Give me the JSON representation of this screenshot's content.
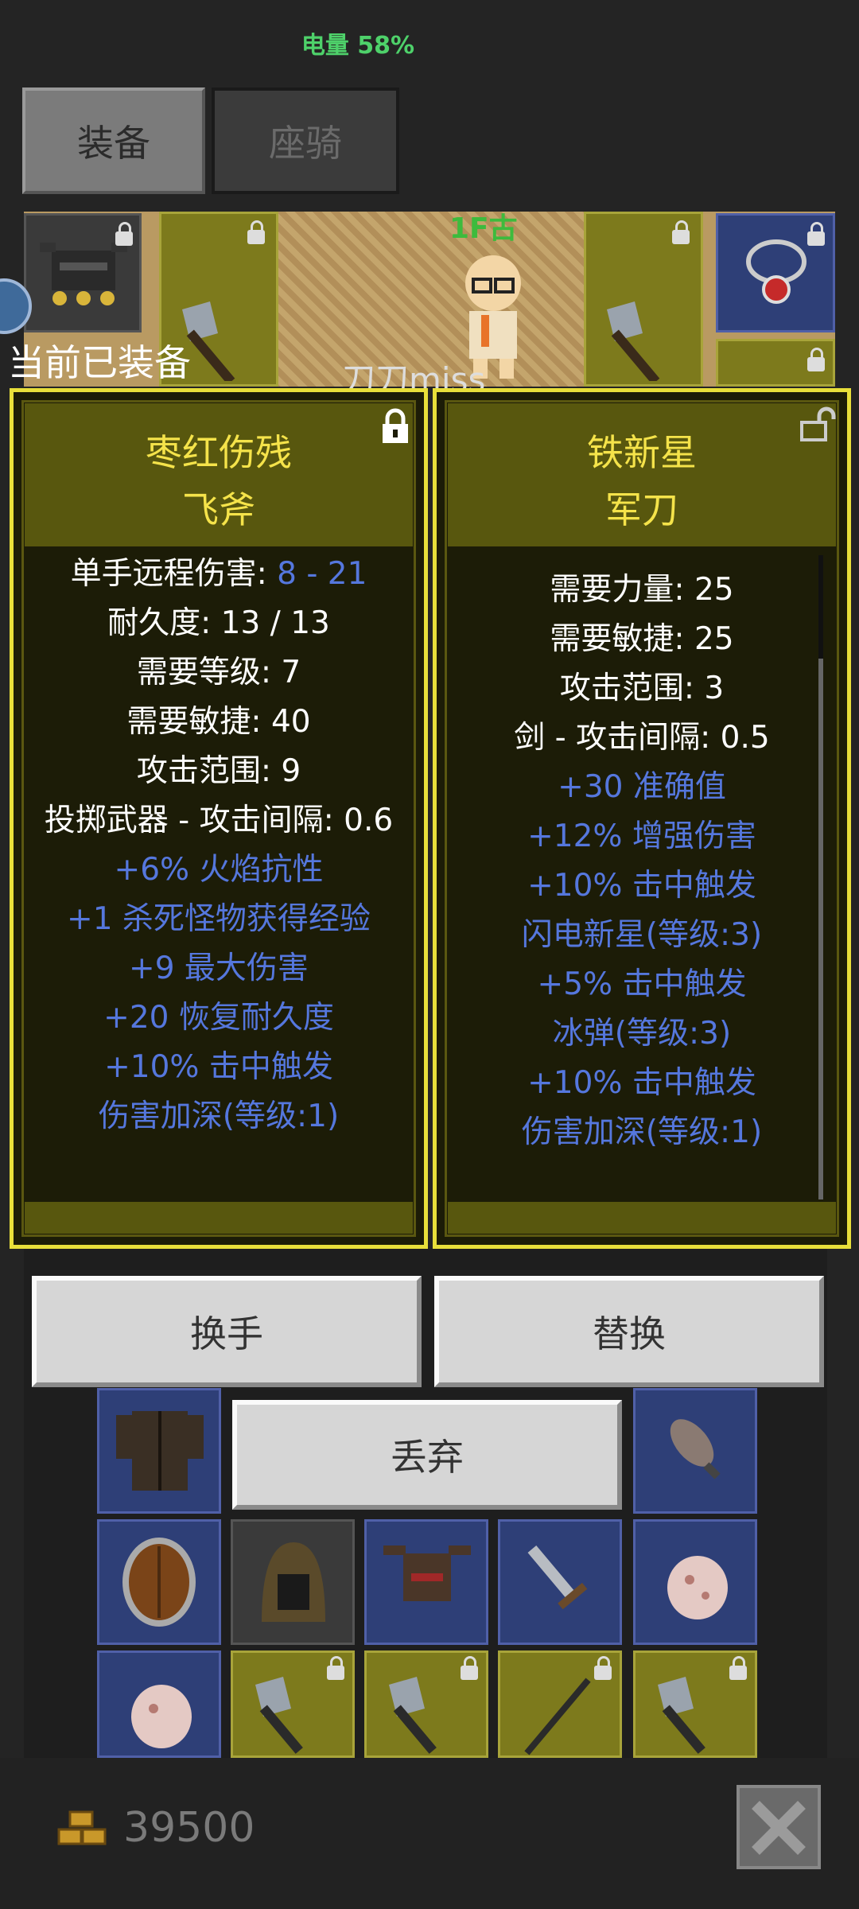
{
  "status_bar": {
    "battery": "电量 58%"
  },
  "tabs": [
    {
      "label": "装备"
    },
    {
      "label": "座骑"
    }
  ],
  "scene": {
    "floor_label": "1F古",
    "combat_text": "刀刀miss"
  },
  "equipped_label": "当前已装备",
  "left_item": {
    "name_line1": "枣红伤残",
    "name_line2": "飞斧",
    "locked": true,
    "stats": [
      {
        "label": "单手远程伤害: ",
        "value": "8 - 21"
      },
      {
        "text": "耐久度: 13 / 13"
      },
      {
        "text": "需要等级: 7"
      },
      {
        "text": "需要敏捷: 40"
      },
      {
        "text": "攻击范围: 9"
      },
      {
        "text": "投掷武器 - 攻击间隔: 0.6"
      }
    ],
    "affixes": [
      "+6% 火焰抗性",
      "+1 杀死怪物获得经验",
      "+9 最大伤害",
      "+20 恢复耐久度",
      "+10% 击中触发",
      "伤害加深(等级:1)"
    ]
  },
  "right_item": {
    "name_line1": "铁新星",
    "name_line2": "军刀",
    "locked": false,
    "stats": [
      {
        "text": "需要力量: 25"
      },
      {
        "text": "需要敏捷: 25"
      },
      {
        "text": "攻击范围: 3"
      },
      {
        "text": "剑 - 攻击间隔: 0.5"
      }
    ],
    "affixes": [
      "+30 准确值",
      "+12% 增强伤害",
      "+10% 击中触发",
      "闪电新星(等级:3)",
      "+5% 击中触发",
      "冰弹(等级:3)",
      "+10% 击中触发",
      "伤害加深(等级:1)"
    ]
  },
  "buttons": {
    "swap_hand": "换手",
    "replace": "替换",
    "discard": "丢弃"
  },
  "gold": {
    "amount": "39500"
  },
  "colors": {
    "panel_border": "#e8df3a",
    "item_name": "#f5e34a",
    "affix": "#5577dd",
    "battery": "#4ed16a"
  }
}
